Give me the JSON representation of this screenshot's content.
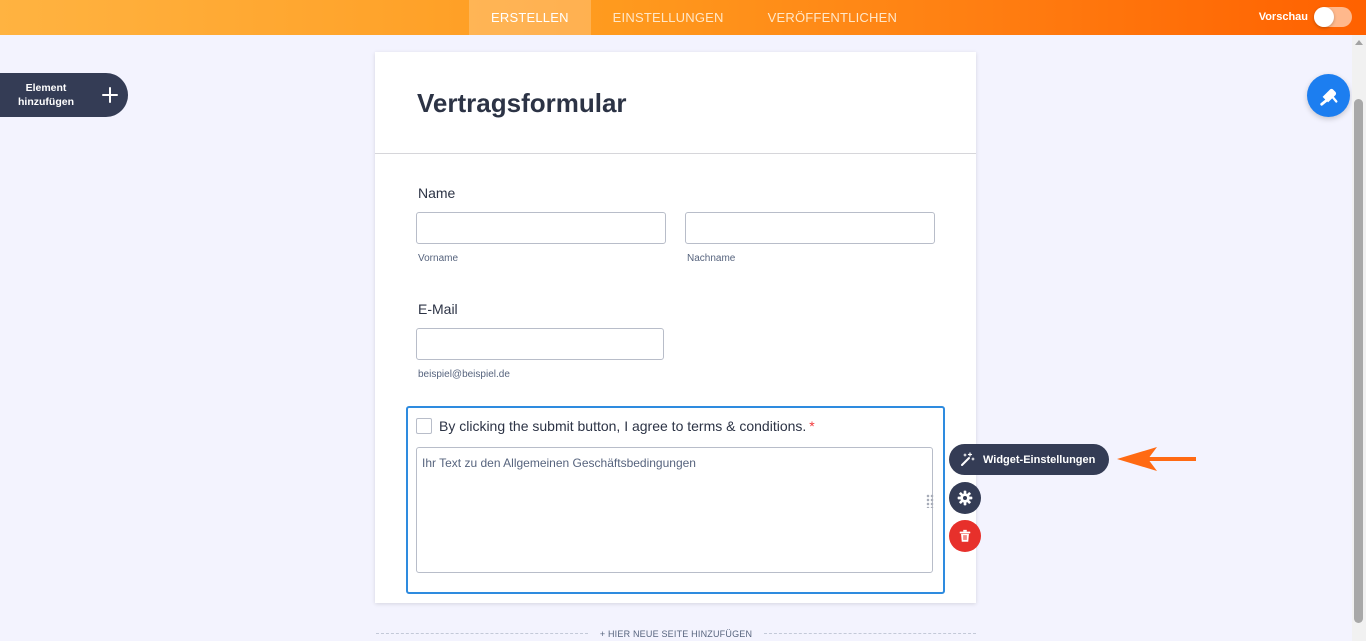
{
  "topbar": {
    "tabs": [
      {
        "label": "ERSTELLEN",
        "active": true
      },
      {
        "label": "EINSTELLUNGEN",
        "active": false
      },
      {
        "label": "VERÖFFENTLICHEN",
        "active": false
      }
    ],
    "preview_label": "Vorschau",
    "preview_on": false,
    "gradient_colors": [
      "#ffb341",
      "#ff6100"
    ]
  },
  "sidebar": {
    "add_element_label_line1": "Element",
    "add_element_label_line2": "hinzufügen",
    "add_icon": "plus-icon"
  },
  "designer_button": {
    "icon": "paint-roller-icon",
    "color": "#1c7ef0"
  },
  "form": {
    "title": "Vertragsformular",
    "name_field": {
      "label": "Name",
      "first_value": "",
      "last_value": "",
      "first_sublabel": "Vorname",
      "last_sublabel": "Nachname"
    },
    "email_field": {
      "label": "E-Mail",
      "value": "",
      "sublabel": "beispiel@beispiel.de"
    },
    "terms": {
      "checked": false,
      "label": "By clicking the submit button, I agree to terms & conditions.",
      "required_mark": "*",
      "text": "Ihr Text zu den Allgemeinen Geschäftsbedingungen",
      "border_color": "#2e8bdf"
    }
  },
  "widget_controls": {
    "settings_label": "Widget-Einstellungen",
    "settings_icon": "magic-wand-icon",
    "gear_icon": "gear-icon",
    "delete_icon": "trash-icon",
    "delete_color": "#e7302b"
  },
  "annotation": {
    "arrow_color": "#ff6a13"
  },
  "add_page": {
    "label": "+ HIER NEUE SEITE HINZUFÜGEN"
  }
}
